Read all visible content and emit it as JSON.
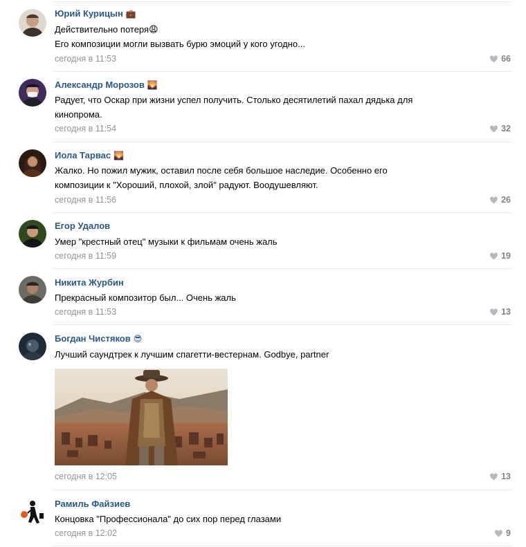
{
  "colors": {
    "author": "#2a5885",
    "meta": "#939393",
    "heart": "#b5b9be",
    "separator": "#e7e8ec"
  },
  "comments": [
    {
      "author": "Юрий Курицын",
      "badge_icon": "briefcase-icon",
      "badge": "💼",
      "lines": [
        "Действительно потеря😩",
        "Его композиции могли вызвать бурю эмоций у кого угодно..."
      ],
      "time": "сегодня в 11:53",
      "likes": "66"
    },
    {
      "author": "Александр Морозов",
      "badge_icon": "sunrise-icon",
      "badge": "🌄",
      "lines": [
        "Радует, что Оскар при жизни успел получить. Столько десятилетий пахал дядька для",
        "кинопрома."
      ],
      "time": "сегодня в 11:54",
      "likes": "32"
    },
    {
      "author": "Иола Тарвас",
      "badge_icon": "sunrise-icon",
      "badge": "🌄",
      "lines": [
        "Жалко. Но пожил мужик, оставил после себя большое наследие. Особенно его",
        "композиции к \"Хороший, плохой, злой\" радуют. Воодушевляют."
      ],
      "time": "сегодня в 11:56",
      "likes": "26"
    },
    {
      "author": "Егор Удалов",
      "badge_icon": "",
      "badge": "",
      "lines": [
        "Умер \"крестный отец\" музыки к фильмам очень жаль"
      ],
      "time": "сегодня в 11:59",
      "likes": "19"
    },
    {
      "author": "Никита Журбин",
      "badge_icon": "",
      "badge": "",
      "lines": [
        "Прекрасный композитор был... Очень жаль"
      ],
      "time": "сегодня в 11:53",
      "likes": "13"
    },
    {
      "author": "Богдан Чистяков",
      "badge_icon": "sunglasses-icon",
      "badge": "😎",
      "lines": [
        "Лучший саундтрек к лучшим спагетти-вестернам. Godbye, partner"
      ],
      "time": "сегодня в 12:05",
      "likes": "13"
    },
    {
      "author": "Рамиль Файзиев",
      "badge_icon": "",
      "badge": "",
      "lines": [
        "Концовка \"Профессионала\" до сих пор перед глазами"
      ],
      "time": "сегодня в 12:02",
      "likes": "9"
    }
  ]
}
